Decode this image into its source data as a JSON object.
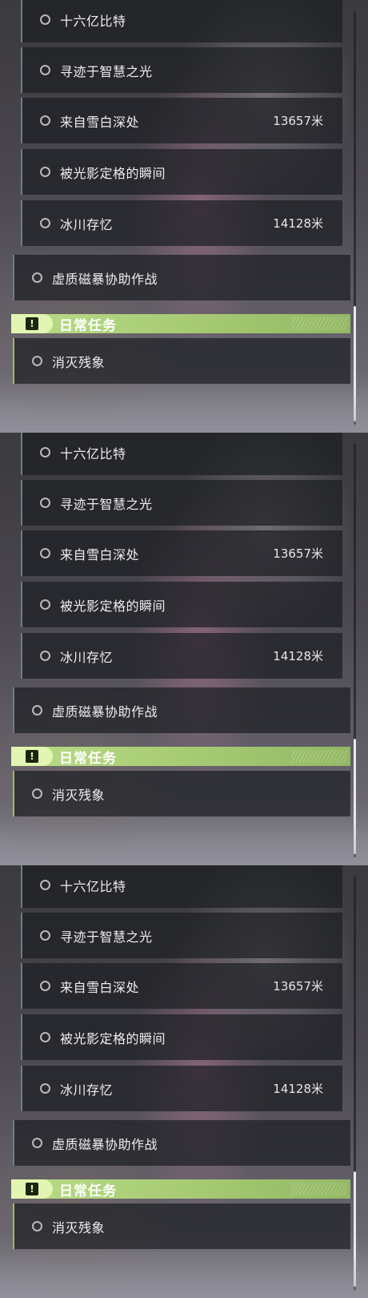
{
  "panels": [
    {
      "main_tasks": [
        {
          "name": "十六亿比特",
          "distance": ""
        },
        {
          "name": "寻迹于智慧之光",
          "distance": ""
        },
        {
          "name": "来自雪白深处",
          "distance": "13657米"
        },
        {
          "name": "被光影定格的瞬间",
          "distance": ""
        },
        {
          "name": "冰川存忆",
          "distance": "14128米"
        }
      ],
      "combat_task": {
        "name": "虚质磁暴协助作战"
      },
      "daily_header": {
        "badge": "!",
        "title": "日常任务"
      },
      "daily_tasks": [
        {
          "name": "消灭残象"
        }
      ]
    },
    {
      "main_tasks": [
        {
          "name": "十六亿比特",
          "distance": ""
        },
        {
          "name": "寻迹于智慧之光",
          "distance": ""
        },
        {
          "name": "来自雪白深处",
          "distance": "13657米"
        },
        {
          "name": "被光影定格的瞬间",
          "distance": ""
        },
        {
          "name": "冰川存忆",
          "distance": "14128米"
        }
      ],
      "combat_task": {
        "name": "虚质磁暴协助作战"
      },
      "daily_header": {
        "badge": "!",
        "title": "日常任务"
      },
      "daily_tasks": [
        {
          "name": "消灭残象"
        }
      ]
    },
    {
      "main_tasks": [
        {
          "name": "十六亿比特",
          "distance": ""
        },
        {
          "name": "寻迹于智慧之光",
          "distance": ""
        },
        {
          "name": "来自雪白深处",
          "distance": "13657米"
        },
        {
          "name": "被光影定格的瞬间",
          "distance": ""
        },
        {
          "name": "冰川存忆",
          "distance": "14128米"
        }
      ],
      "combat_task": {
        "name": "虚质磁暴协助作战"
      },
      "daily_header": {
        "badge": "!",
        "title": "日常任务"
      },
      "daily_tasks": [
        {
          "name": "消灭残象"
        }
      ]
    }
  ],
  "colors": {
    "daily_accent": "#b9dc88",
    "main_border": "#6a7e8c",
    "row_bg": "#1c1e22"
  }
}
